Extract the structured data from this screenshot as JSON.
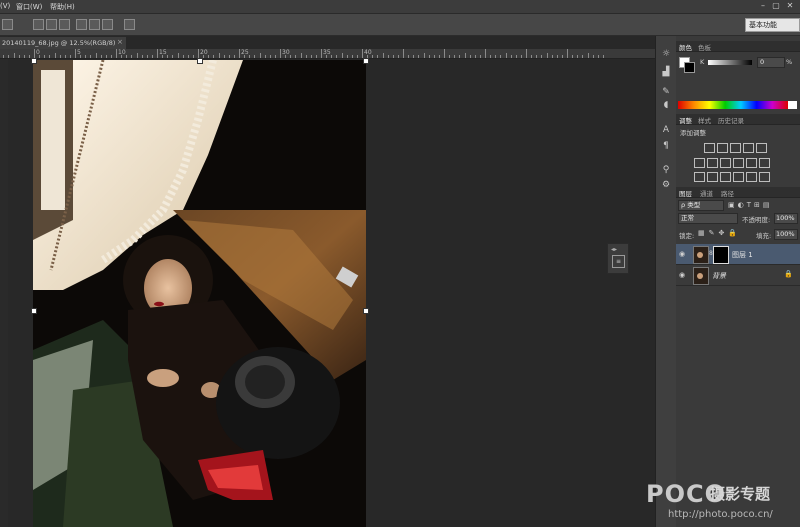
{
  "menu": {
    "items": [
      "(V)",
      "窗口(W)",
      "帮助(H)"
    ],
    "window_buttons": [
      "–",
      "▢",
      "✕"
    ]
  },
  "options_bar": {
    "workspace_label": "基本功能"
  },
  "document": {
    "tab_title": "20140119_68.jpg @ 12.5%(RGB/8)",
    "close_glyph": "×",
    "ruler_labels": [
      "10",
      "5",
      "0",
      "5",
      "10",
      "15",
      "20",
      "25",
      "30",
      "35",
      "40"
    ]
  },
  "panels": {
    "color": {
      "tabs": [
        "颜色",
        "色板"
      ],
      "channel_label": "K",
      "channel_value": "0",
      "unit": "%"
    },
    "adjustments": {
      "tabs": [
        "调整",
        "样式",
        "历史记录"
      ],
      "title": "添加调整"
    },
    "layers": {
      "tabs": [
        "图层",
        "通道",
        "路径"
      ],
      "filter_label": "ρ 类型",
      "blend_mode": "正常",
      "opacity_label": "不透明度:",
      "opacity_value": "100%",
      "lock_label": "锁定:",
      "fill_label": "填充:",
      "fill_value": "100%",
      "rows": [
        {
          "name": "图层 1"
        },
        {
          "name": "背景"
        }
      ]
    }
  },
  "watermark": {
    "logo": "POCO",
    "title": "摄影专题",
    "url": "http://photo.poco.cn/"
  },
  "colors": {
    "ui_dark": "#282828",
    "panel": "#3a3a3a",
    "selection": "#4a5a70",
    "accent_red": "#c22030"
  }
}
